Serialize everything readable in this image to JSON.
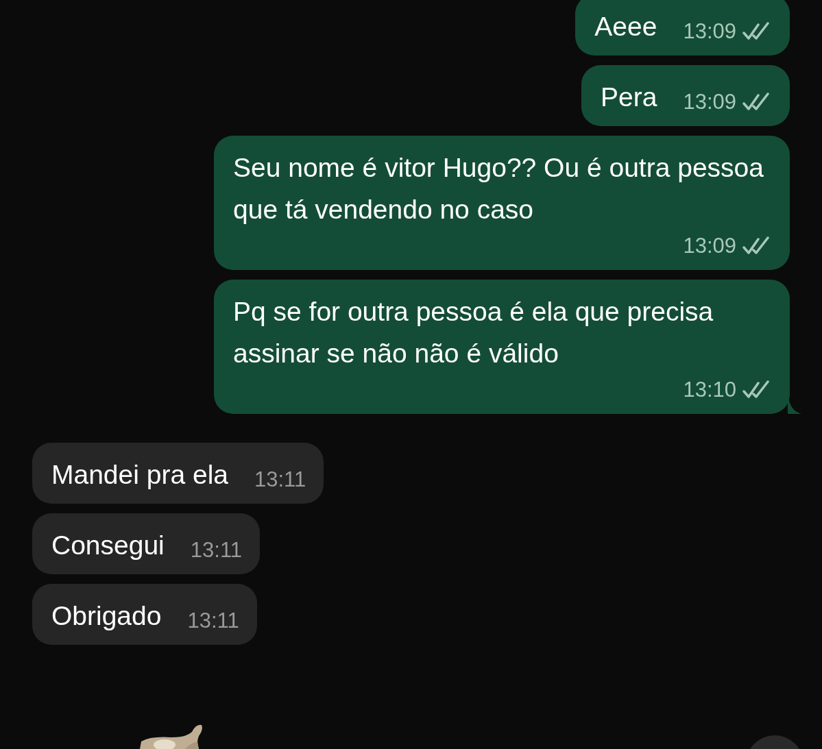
{
  "messages": [
    {
      "kind": "outgoing",
      "text": "Aeee",
      "time": "13:09",
      "read": false,
      "tail": false
    },
    {
      "kind": "outgoing",
      "text": "Pera",
      "time": "13:09",
      "read": false,
      "tail": false
    },
    {
      "kind": "outgoing",
      "text": "Seu nome é vitor Hugo?? Ou é outra pessoa que tá vendendo no caso",
      "time": "13:09",
      "read": false,
      "tail": false
    },
    {
      "kind": "outgoing",
      "text": "Pq se for outra pessoa é ela que precisa assinar se não não é válido",
      "time": "13:10",
      "read": false,
      "tail": true
    },
    {
      "kind": "incoming",
      "text": "Mandei pra ela",
      "time": "13:11"
    },
    {
      "kind": "incoming",
      "text": "Consegui",
      "time": "13:11"
    },
    {
      "kind": "incoming",
      "text": "Obrigado",
      "time": "13:11"
    },
    {
      "kind": "sticker"
    }
  ]
}
